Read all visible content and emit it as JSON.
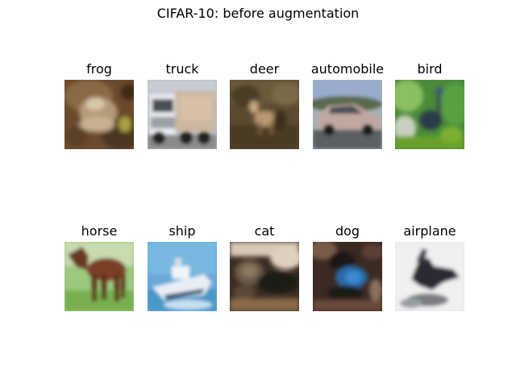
{
  "figure": {
    "title": "CIFAR-10: before augmentation"
  },
  "images": [
    {
      "label": "frog",
      "subject": "frog-photo"
    },
    {
      "label": "truck",
      "subject": "truck-photo"
    },
    {
      "label": "deer",
      "subject": "deer-photo"
    },
    {
      "label": "automobile",
      "subject": "automobile-photo"
    },
    {
      "label": "bird",
      "subject": "bird-photo"
    },
    {
      "label": "horse",
      "subject": "horse-photo"
    },
    {
      "label": "ship",
      "subject": "ship-photo"
    },
    {
      "label": "cat",
      "subject": "cat-photo"
    },
    {
      "label": "dog",
      "subject": "dog-photo"
    },
    {
      "label": "airplane",
      "subject": "airplane-photo"
    }
  ]
}
